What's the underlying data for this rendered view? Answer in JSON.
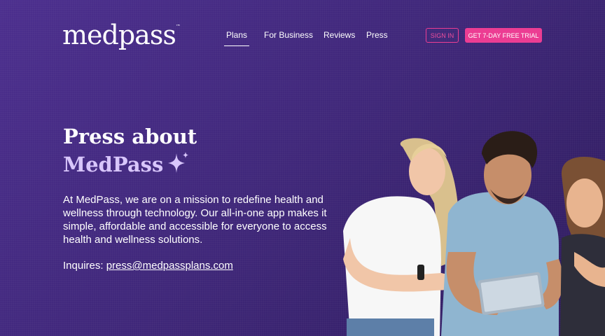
{
  "header": {
    "logo_text": "medpass",
    "logo_tm": "™",
    "nav": [
      {
        "label": "Plans",
        "active": true
      },
      {
        "label": "For Business",
        "active": false
      },
      {
        "label": "Reviews",
        "active": false
      },
      {
        "label": "Press",
        "active": false
      }
    ],
    "signin_label": "SIGN IN",
    "trial_label": "GET 7-DAY FREE TRIAL"
  },
  "hero": {
    "title_line1": "Press about",
    "title_line2": "MedPass",
    "body": "At MedPass, we are on a mission to redefine health and wellness through technology. Our all-in-one app makes it simple, affordable and accessible for everyone to access health and wellness solutions.",
    "inquires_label": "Inquires:",
    "inquires_email": "press@medpassplans.com"
  },
  "colors": {
    "background": "#432a82",
    "accent_pink": "#ec3d93",
    "title_lavender": "#d8c6fb"
  },
  "icons": [
    "sparkle-icon"
  ],
  "image": "photo of three young people looking at a tablet"
}
